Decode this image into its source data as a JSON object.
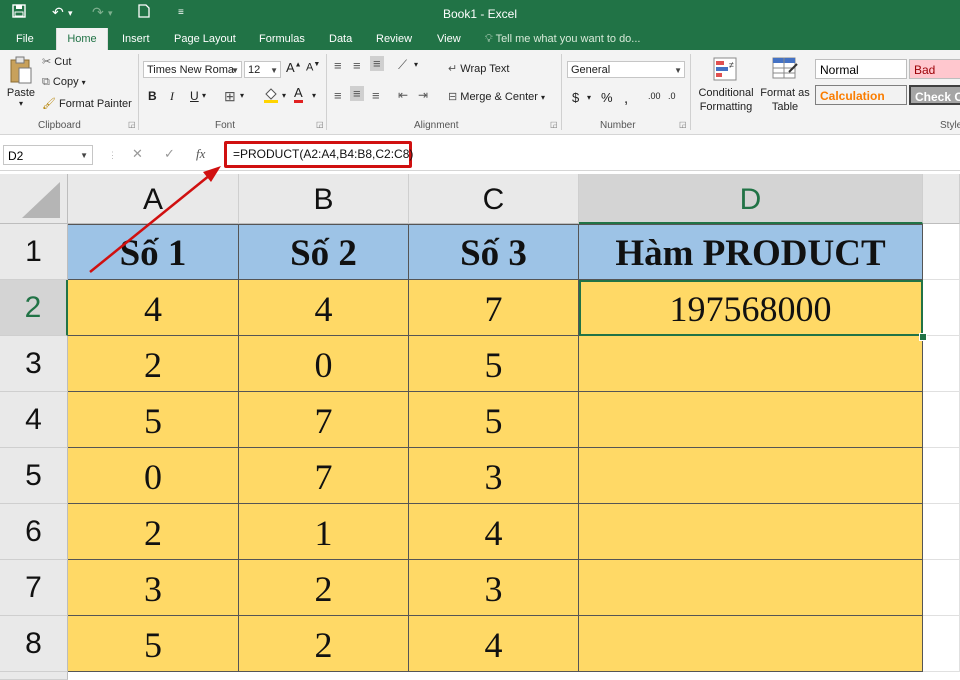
{
  "window": {
    "title": "Book1  -  Excel"
  },
  "tabs": [
    "File",
    "Home",
    "Insert",
    "Page Layout",
    "Formulas",
    "Data",
    "Review",
    "View"
  ],
  "tell_me": "Tell me what you want to do...",
  "ribbon": {
    "clipboard": {
      "paste": "Paste",
      "cut": "Cut",
      "copy": "Copy",
      "format_painter": "Format Painter",
      "label": "Clipboard"
    },
    "font": {
      "family": "Times New Roma",
      "size": "12",
      "label": "Font"
    },
    "alignment": {
      "wrap_text": "Wrap Text",
      "merge_center": "Merge & Center",
      "label": "Alignment"
    },
    "number": {
      "format": "General",
      "label": "Number"
    },
    "styles": {
      "conditional_formatting": "Conditional Formatting",
      "format_as_table": "Format as Table",
      "normal": "Normal",
      "bad": "Bad",
      "calculation": "Calculation",
      "check_cell": "Check Ce",
      "label": "Style"
    }
  },
  "formula_bar": {
    "name_box": "D2",
    "formula": "=PRODUCT(A2:A4,B4:B8,C2:C8)"
  },
  "columns": [
    "A",
    "B",
    "C",
    "D"
  ],
  "rows": [
    "1",
    "2",
    "3",
    "4",
    "5",
    "6",
    "7",
    "8"
  ],
  "sheet": {
    "headers": [
      "Số 1",
      "Số 2",
      "Số 3",
      "Hàm PRODUCT"
    ],
    "data": [
      [
        "4",
        "4",
        "7",
        "197568000"
      ],
      [
        "2",
        "0",
        "5",
        ""
      ],
      [
        "5",
        "7",
        "5",
        ""
      ],
      [
        "0",
        "7",
        "3",
        ""
      ],
      [
        "2",
        "1",
        "4",
        ""
      ],
      [
        "3",
        "2",
        "3",
        ""
      ],
      [
        "5",
        "2",
        "4",
        ""
      ]
    ]
  },
  "colors": {
    "excel_green": "#217346",
    "header_fill": "#9dc3e6",
    "data_fill": "#ffd966",
    "highlight": "#d01010"
  }
}
